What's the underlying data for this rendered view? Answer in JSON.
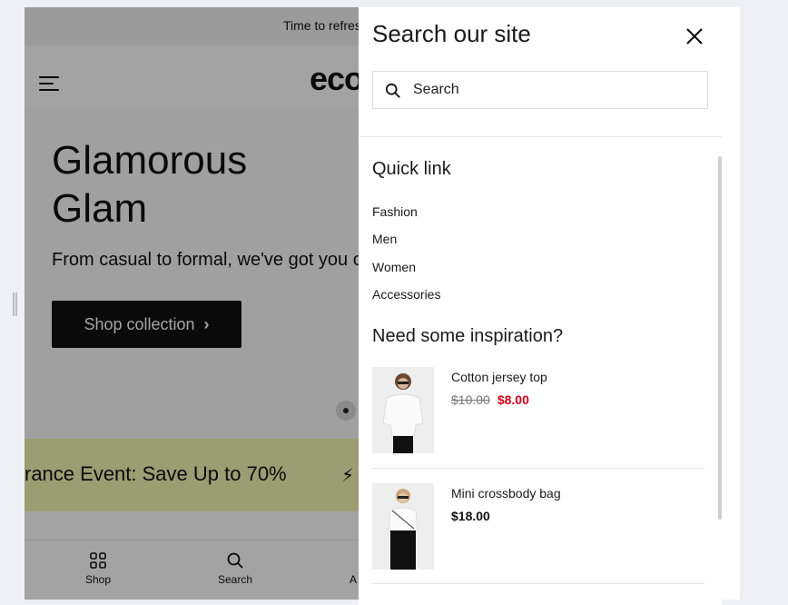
{
  "announcement": "Time to refresh your wardrobe",
  "store": {
    "logo": "ecomus",
    "hero_title": "Glamorous Glam",
    "hero_subtitle": "From casual to formal, we've got you covered",
    "hero_button": "Shop collection",
    "marquee": "rance Event: Save Up to 70%",
    "tabs": [
      {
        "label": "Shop",
        "icon": "grid-icon"
      },
      {
        "label": "Search",
        "icon": "search-icon"
      },
      {
        "label": "A",
        "icon": "account-icon"
      }
    ]
  },
  "drawer": {
    "title": "Search our site",
    "search_placeholder": "Search",
    "quick_link_heading": "Quick link",
    "quick_links": [
      "Fashion",
      "Men",
      "Women",
      "Accessories"
    ],
    "inspiration_heading": "Need some inspiration?",
    "products": [
      {
        "name": "Cotton jersey top",
        "old_price": "$10.00",
        "price": "$8.00"
      },
      {
        "name": "Mini crossbody bag",
        "old_price": "",
        "price": "$18.00"
      }
    ]
  },
  "colors": {
    "sale_price": "#d0021b",
    "marquee_bg": "#f2f6b4",
    "button_bg": "#111111"
  }
}
